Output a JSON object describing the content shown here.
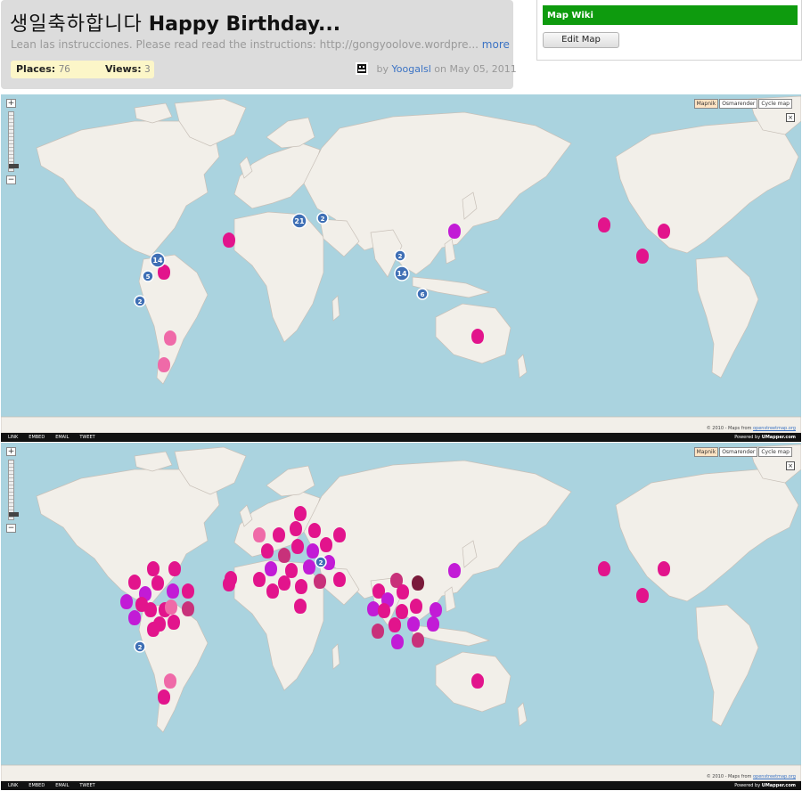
{
  "header": {
    "title_korean": "생일축하합니다",
    "title_english": "Happy Birthday...",
    "description": "Lean las instrucciones. Please read read the instructions: http://gongyoolove.wordpre...",
    "more_link": "more",
    "places_label": "Places:",
    "places_value": "76",
    "views_label": "Views:",
    "views_value": "3",
    "by_label": "by",
    "author": "Yoogalsl",
    "date_text": "on May 05, 2011"
  },
  "wiki": {
    "title": "Map Wiki",
    "edit_button": "Edit Map"
  },
  "map_controls": {
    "zoom_in": "+",
    "zoom_out": "−",
    "layers": [
      "Mapnik",
      "Osmarender",
      "Cycle map"
    ],
    "active_layer": "Mapnik",
    "fullscreen_icon": "×",
    "attribution": "© 2010 - Maps from",
    "attribution_link": "openstreetmap.org"
  },
  "footer": {
    "links": [
      "LINK",
      "EMBED",
      "EMAIL",
      "TWEET"
    ],
    "powered_prefix": "Powered by",
    "powered_brand": "UMapper.com"
  },
  "colors": {
    "ocean": "#aad3df",
    "land": "#f2efe9",
    "cluster": "#3f6fb5",
    "wiki_green": "#0e9b0e",
    "link_blue": "#3b73c4",
    "pin_magenta": "#e2148c",
    "pin_violet": "#c21bd6",
    "pin_pink": "#ef6aa8"
  },
  "map1": {
    "clusters": [
      "21",
      "2",
      "14",
      "5",
      "2",
      "2",
      "14",
      "6"
    ]
  },
  "map2": {
    "clusters": [
      "2",
      "2"
    ]
  }
}
